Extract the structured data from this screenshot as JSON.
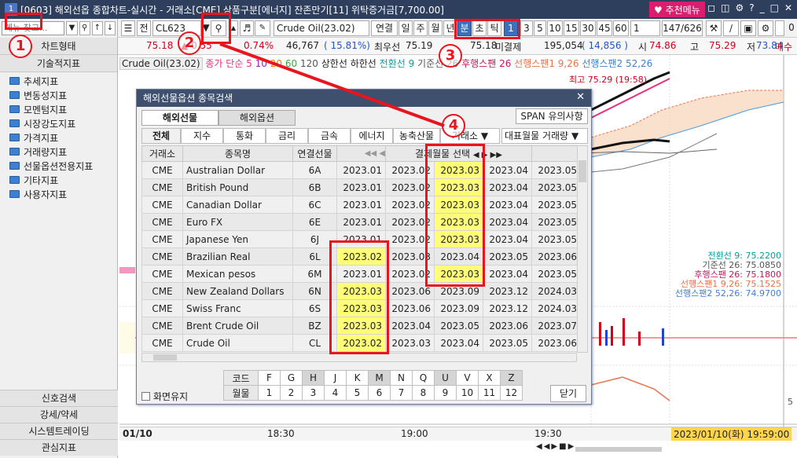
{
  "titlebar": {
    "screen_no": "1",
    "title": "[0603] 해외선옵 종합차트-실시간 - 거래소[CME] 상품구분[에너지] 잔존만기[11] 위탁증거금[7,700.00]",
    "menu_button": "추천메뉴"
  },
  "sidebar": {
    "combo_value": "메뉴 찾고...",
    "header_chart_type": "차트형태",
    "header_tech": "기술적지표",
    "folders": [
      "추세지표",
      "변동성지표",
      "모멘텀지표",
      "시장강도지표",
      "가격지표",
      "거래량지표",
      "선물옵션전용지표",
      "기타지표",
      "사용자지표"
    ],
    "bottom_tabs": [
      "신호검색",
      "강세/약세",
      "시스템트레이딩",
      "관심지표"
    ]
  },
  "toolbar": {
    "all_label": "전",
    "code_value": "CL623",
    "product_name": "Crude Oil(23.02)",
    "period_buttons": [
      "연결",
      "일",
      "주",
      "월",
      "년"
    ],
    "unit_buttons": [
      "분",
      "초",
      "틱"
    ],
    "unit_value": "1",
    "minute_buttons": [
      "3",
      "5",
      "10",
      "15",
      "30",
      "45",
      "60"
    ],
    "count_value": "1",
    "page_count": "147/626",
    "checkbox_value": "0"
  },
  "quote": {
    "price": "75.18",
    "change": "0.55",
    "change_pct": "0.74%",
    "volume": "46,767",
    "volume_pct": "( 15.81%)",
    "best_bid_label": "최우선",
    "best_bid": "75.19",
    "last": "75.18",
    "unsettled_label": "미결제",
    "unsettled": "195,054",
    "unsettled_change": "( 14,856 )",
    "open_label": "시",
    "open": "74.86",
    "high_label": "고",
    "high": "75.29",
    "low_label": "저",
    "low": "73.84",
    "buy_label": "매수"
  },
  "legend": {
    "series_name": "Crude Oil(23.02)",
    "ma_label": "종가 단순",
    "ma_periods": [
      "5",
      "10",
      "20",
      "60",
      "120"
    ],
    "upper_limit": "상한선",
    "lower_limit": "하한선",
    "ichimoku": [
      "전환선 9",
      "기준선 26",
      "후행스팬 26",
      "선행스팬1 9,26",
      "선행스팬2 52,26"
    ],
    "high_marker": "최고 75.29 (19:58)"
  },
  "right_labels": [
    "전환선 9: 75.2200",
    "기준선 26: 75.0850",
    "후행스팬 26: 75.1800",
    "선행스팬1 9,26: 75.1525",
    "선행스팬2 52,26: 74.9700"
  ],
  "time_axis": [
    "01/10",
    "18:30",
    "19:00",
    "19:30"
  ],
  "status_datetime": "2023/01/10(화) 19:59:00",
  "dialog": {
    "title": "해외선물옵션 종목검색",
    "tabs": [
      "해외선물",
      "해외옵션"
    ],
    "span_button": "SPAN 유의사항",
    "categories": [
      "전체",
      "지수",
      "통화",
      "금리",
      "금속",
      "에너지",
      "농축산물",
      "거래소"
    ],
    "sort_select": "대표월물 거래량",
    "columns": [
      "거래소",
      "종목명",
      "연결선물"
    ],
    "month_header": "결제월물 선택",
    "rows": [
      {
        "ex": "CME",
        "name": "Australian Dollar",
        "code": "6A",
        "m": [
          "2023.01",
          "2023.02",
          "2023.03",
          "2023.04",
          "2023.05"
        ]
      },
      {
        "ex": "CME",
        "name": "British Pound",
        "code": "6B",
        "m": [
          "2023.01",
          "2023.02",
          "2023.03",
          "2023.04",
          "2023.05"
        ]
      },
      {
        "ex": "CME",
        "name": "Canadian Dollar",
        "code": "6C",
        "m": [
          "2023.01",
          "2023.02",
          "2023.03",
          "2023.04",
          "2023.05"
        ]
      },
      {
        "ex": "CME",
        "name": "Euro FX",
        "code": "6E",
        "m": [
          "2023.01",
          "2023.02",
          "2023.03",
          "2023.04",
          "2023.05"
        ]
      },
      {
        "ex": "CME",
        "name": "Japanese Yen",
        "code": "6J",
        "m": [
          "2023.01",
          "2023.02",
          "2023.03",
          "2023.04",
          "2023.05"
        ]
      },
      {
        "ex": "CME",
        "name": "Brazilian Real",
        "code": "6L",
        "m": [
          "2023.02",
          "2023.03",
          "2023.04",
          "2023.05",
          "2023.06"
        ]
      },
      {
        "ex": "CME",
        "name": "Mexican pesos",
        "code": "6M",
        "m": [
          "2023.01",
          "2023.02",
          "2023.03",
          "2023.04",
          "2023.05"
        ]
      },
      {
        "ex": "CME",
        "name": "New Zealand Dollars",
        "code": "6N",
        "m": [
          "2023.03",
          "2023.06",
          "2023.09",
          "2023.12",
          "2024.03"
        ]
      },
      {
        "ex": "CME",
        "name": "Swiss Franc",
        "code": "6S",
        "m": [
          "2023.03",
          "2023.06",
          "2023.09",
          "2023.12",
          "2024.03"
        ]
      },
      {
        "ex": "CME",
        "name": "Brent Crude Oil",
        "code": "BZ",
        "m": [
          "2023.03",
          "2023.04",
          "2023.05",
          "2023.06",
          "2023.07"
        ]
      },
      {
        "ex": "CME",
        "name": "Crude Oil",
        "code": "CL",
        "m": [
          "2023.02",
          "2023.03",
          "2023.04",
          "2023.05",
          "2023.06"
        ]
      }
    ],
    "code_label": "코드",
    "month_label": "월물",
    "codes": [
      "F",
      "G",
      "H",
      "J",
      "K",
      "M",
      "N",
      "Q",
      "U",
      "V",
      "X",
      "Z"
    ],
    "months": [
      "1",
      "2",
      "3",
      "4",
      "5",
      "6",
      "7",
      "8",
      "9",
      "10",
      "11",
      "12"
    ],
    "keep_screen_label": "화면유지",
    "close_button": "닫기"
  },
  "annotations": [
    "1",
    "2",
    "3",
    "4"
  ],
  "y_axis_ticks": [
    "5"
  ]
}
